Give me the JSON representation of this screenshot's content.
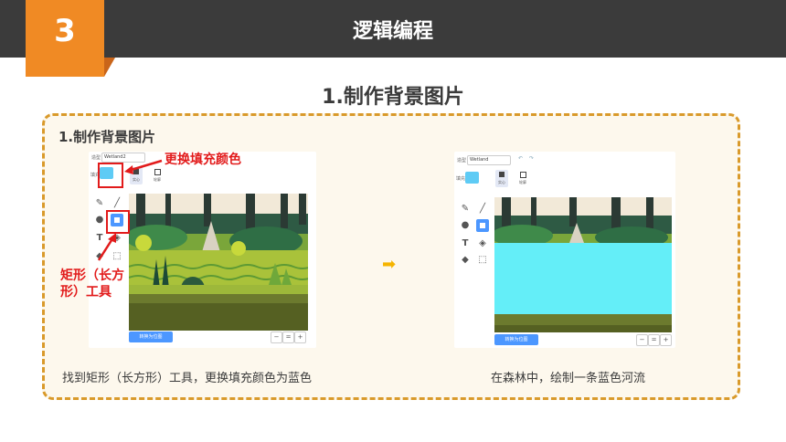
{
  "header": {
    "number": "3",
    "title": "逻辑编程"
  },
  "section_title": "1.制作背景图片",
  "panel": {
    "heading": "1.制作背景图片",
    "annotations": {
      "fill_color": "更换填充颜色",
      "rect_tool": "矩形（长方形）工具"
    },
    "arrow_symbol": "➡",
    "left": {
      "name_label": "造型",
      "costume_name": "Wetland2",
      "fill_label": "填充",
      "mode_fill": "实心",
      "mode_outline": "轮廓",
      "convert_button": "转换为位图",
      "caption": "找到矩形（长方形）工具，更换填充颜色为蓝色"
    },
    "right": {
      "name_label": "造型",
      "costume_name": "Wetland",
      "fill_label": "填充",
      "mode_fill": "实心",
      "mode_outline": "轮廓",
      "convert_button": "转换为位图",
      "caption": "在森林中，绘制一条蓝色河流"
    }
  },
  "colors": {
    "accent": "#f08a24",
    "dark": "#3b3b3b",
    "annotation": "#e21b1b",
    "fill_swatch": "#5ecbf5",
    "river": "#64eef8",
    "panel_border": "#d99a2b"
  },
  "icons": [
    "brush-icon",
    "line-icon",
    "circle-icon",
    "rectangle-icon",
    "text-icon",
    "fill-icon",
    "eraser-icon",
    "select-icon",
    "zoom-out-icon",
    "zoom-reset-icon",
    "zoom-in-icon",
    "arrow-right-icon"
  ]
}
